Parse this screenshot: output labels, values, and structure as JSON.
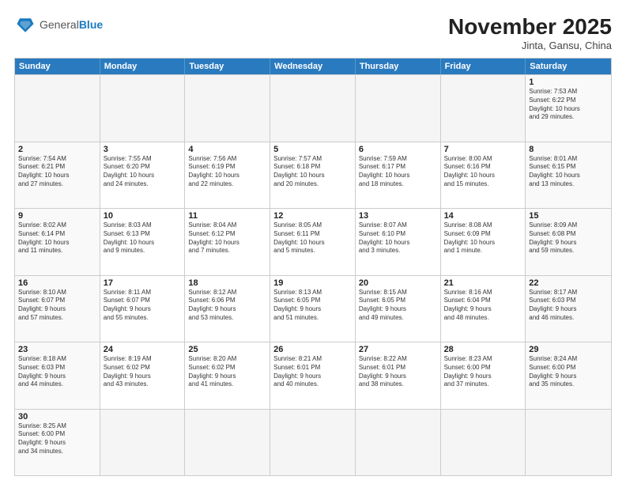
{
  "header": {
    "logo_general": "General",
    "logo_blue": "Blue",
    "month_title": "November 2025",
    "subtitle": "Jinta, Gansu, China"
  },
  "days_of_week": [
    "Sunday",
    "Monday",
    "Tuesday",
    "Wednesday",
    "Thursday",
    "Friday",
    "Saturday"
  ],
  "weeks": [
    [
      {
        "day": "",
        "text": "",
        "empty": true
      },
      {
        "day": "",
        "text": "",
        "empty": true
      },
      {
        "day": "",
        "text": "",
        "empty": true
      },
      {
        "day": "",
        "text": "",
        "empty": true
      },
      {
        "day": "",
        "text": "",
        "empty": true
      },
      {
        "day": "",
        "text": "",
        "empty": true
      },
      {
        "day": "1",
        "text": "Sunrise: 7:53 AM\nSunset: 6:22 PM\nDaylight: 10 hours\nand 29 minutes."
      }
    ],
    [
      {
        "day": "2",
        "text": "Sunrise: 7:54 AM\nSunset: 6:21 PM\nDaylight: 10 hours\nand 27 minutes."
      },
      {
        "day": "3",
        "text": "Sunrise: 7:55 AM\nSunset: 6:20 PM\nDaylight: 10 hours\nand 24 minutes."
      },
      {
        "day": "4",
        "text": "Sunrise: 7:56 AM\nSunset: 6:19 PM\nDaylight: 10 hours\nand 22 minutes."
      },
      {
        "day": "5",
        "text": "Sunrise: 7:57 AM\nSunset: 6:18 PM\nDaylight: 10 hours\nand 20 minutes."
      },
      {
        "day": "6",
        "text": "Sunrise: 7:59 AM\nSunset: 6:17 PM\nDaylight: 10 hours\nand 18 minutes."
      },
      {
        "day": "7",
        "text": "Sunrise: 8:00 AM\nSunset: 6:16 PM\nDaylight: 10 hours\nand 15 minutes."
      },
      {
        "day": "8",
        "text": "Sunrise: 8:01 AM\nSunset: 6:15 PM\nDaylight: 10 hours\nand 13 minutes."
      }
    ],
    [
      {
        "day": "9",
        "text": "Sunrise: 8:02 AM\nSunset: 6:14 PM\nDaylight: 10 hours\nand 11 minutes."
      },
      {
        "day": "10",
        "text": "Sunrise: 8:03 AM\nSunset: 6:13 PM\nDaylight: 10 hours\nand 9 minutes."
      },
      {
        "day": "11",
        "text": "Sunrise: 8:04 AM\nSunset: 6:12 PM\nDaylight: 10 hours\nand 7 minutes."
      },
      {
        "day": "12",
        "text": "Sunrise: 8:05 AM\nSunset: 6:11 PM\nDaylight: 10 hours\nand 5 minutes."
      },
      {
        "day": "13",
        "text": "Sunrise: 8:07 AM\nSunset: 6:10 PM\nDaylight: 10 hours\nand 3 minutes."
      },
      {
        "day": "14",
        "text": "Sunrise: 8:08 AM\nSunset: 6:09 PM\nDaylight: 10 hours\nand 1 minute."
      },
      {
        "day": "15",
        "text": "Sunrise: 8:09 AM\nSunset: 6:08 PM\nDaylight: 9 hours\nand 59 minutes."
      }
    ],
    [
      {
        "day": "16",
        "text": "Sunrise: 8:10 AM\nSunset: 6:07 PM\nDaylight: 9 hours\nand 57 minutes."
      },
      {
        "day": "17",
        "text": "Sunrise: 8:11 AM\nSunset: 6:07 PM\nDaylight: 9 hours\nand 55 minutes."
      },
      {
        "day": "18",
        "text": "Sunrise: 8:12 AM\nSunset: 6:06 PM\nDaylight: 9 hours\nand 53 minutes."
      },
      {
        "day": "19",
        "text": "Sunrise: 8:13 AM\nSunset: 6:05 PM\nDaylight: 9 hours\nand 51 minutes."
      },
      {
        "day": "20",
        "text": "Sunrise: 8:15 AM\nSunset: 6:05 PM\nDaylight: 9 hours\nand 49 minutes."
      },
      {
        "day": "21",
        "text": "Sunrise: 8:16 AM\nSunset: 6:04 PM\nDaylight: 9 hours\nand 48 minutes."
      },
      {
        "day": "22",
        "text": "Sunrise: 8:17 AM\nSunset: 6:03 PM\nDaylight: 9 hours\nand 46 minutes."
      }
    ],
    [
      {
        "day": "23",
        "text": "Sunrise: 8:18 AM\nSunset: 6:03 PM\nDaylight: 9 hours\nand 44 minutes."
      },
      {
        "day": "24",
        "text": "Sunrise: 8:19 AM\nSunset: 6:02 PM\nDaylight: 9 hours\nand 43 minutes."
      },
      {
        "day": "25",
        "text": "Sunrise: 8:20 AM\nSunset: 6:02 PM\nDaylight: 9 hours\nand 41 minutes."
      },
      {
        "day": "26",
        "text": "Sunrise: 8:21 AM\nSunset: 6:01 PM\nDaylight: 9 hours\nand 40 minutes."
      },
      {
        "day": "27",
        "text": "Sunrise: 8:22 AM\nSunset: 6:01 PM\nDaylight: 9 hours\nand 38 minutes."
      },
      {
        "day": "28",
        "text": "Sunrise: 8:23 AM\nSunset: 6:00 PM\nDaylight: 9 hours\nand 37 minutes."
      },
      {
        "day": "29",
        "text": "Sunrise: 8:24 AM\nSunset: 6:00 PM\nDaylight: 9 hours\nand 35 minutes."
      }
    ],
    [
      {
        "day": "30",
        "text": "Sunrise: 8:25 AM\nSunset: 6:00 PM\nDaylight: 9 hours\nand 34 minutes."
      },
      {
        "day": "",
        "text": "",
        "empty": true
      },
      {
        "day": "",
        "text": "",
        "empty": true
      },
      {
        "day": "",
        "text": "",
        "empty": true
      },
      {
        "day": "",
        "text": "",
        "empty": true
      },
      {
        "day": "",
        "text": "",
        "empty": true
      },
      {
        "day": "",
        "text": "",
        "empty": true
      }
    ]
  ]
}
